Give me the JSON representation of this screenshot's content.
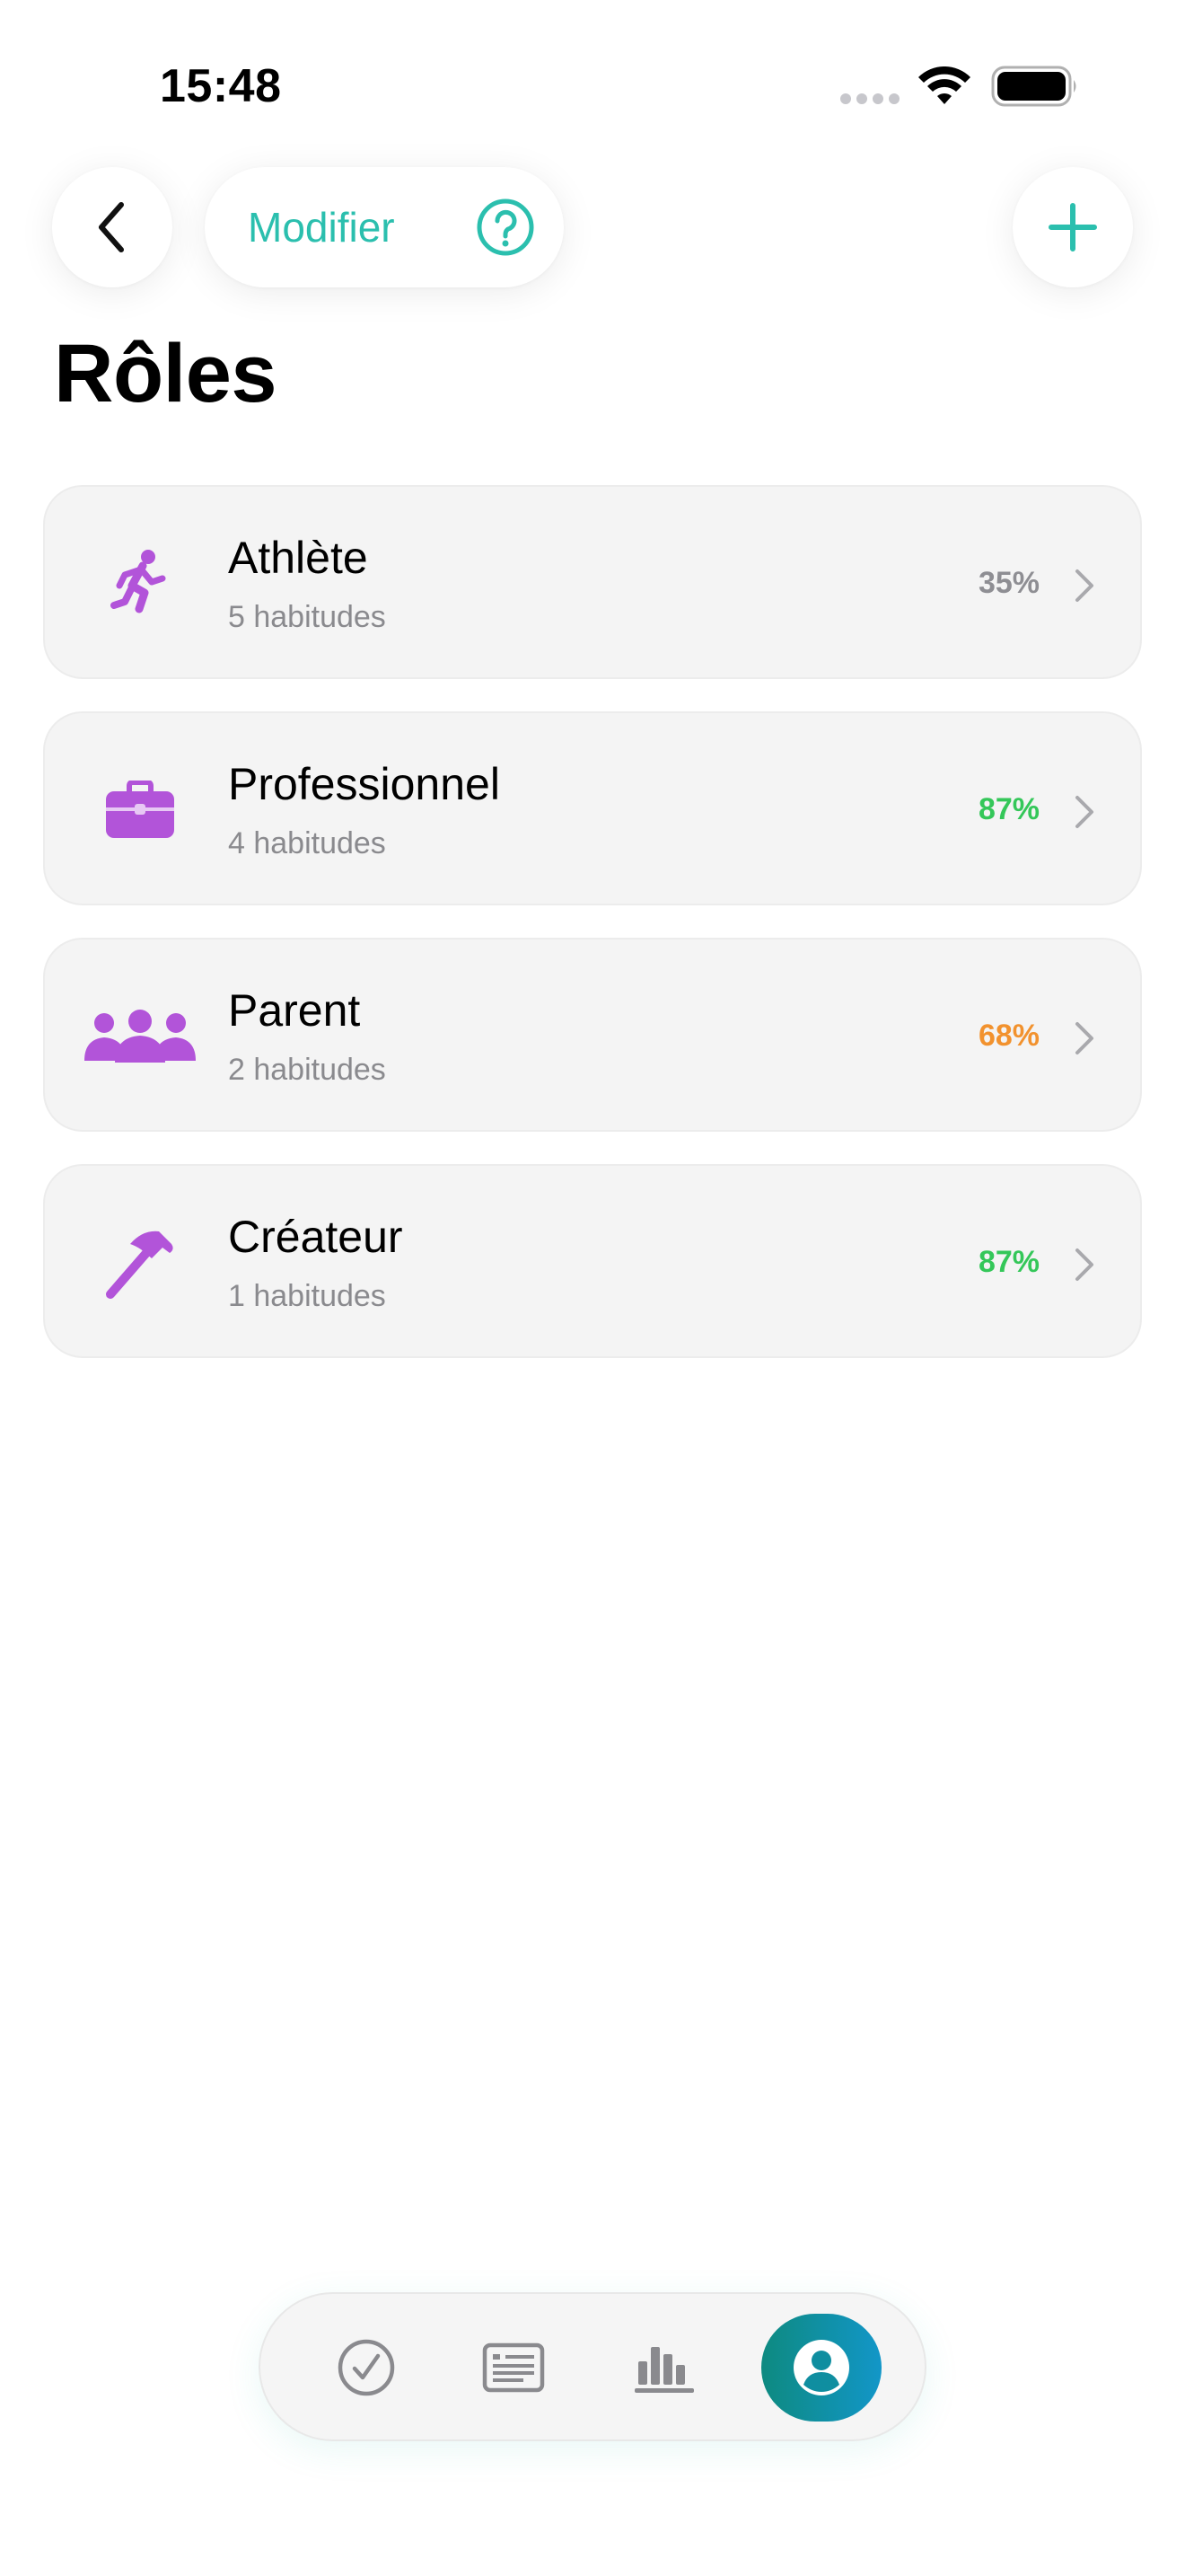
{
  "status_bar": {
    "time": "15:48"
  },
  "header": {
    "edit_label": "Modifier"
  },
  "page": {
    "title": "Rôles"
  },
  "roles": [
    {
      "name": "Athlète",
      "count": "5 habitudes",
      "percent": "35%",
      "percent_color": "#8e8e93",
      "icon": "running-person-icon"
    },
    {
      "name": "Professionnel",
      "count": "4 habitudes",
      "percent": "87%",
      "percent_color": "#34c759",
      "icon": "briefcase-icon"
    },
    {
      "name": "Parent",
      "count": "2 habitudes",
      "percent": "68%",
      "percent_color": "#f2922e",
      "icon": "group-icon"
    },
    {
      "name": "Créateur",
      "count": "1 habitudes",
      "percent": "87%",
      "percent_color": "#34c759",
      "icon": "hammer-icon"
    }
  ],
  "colors": {
    "accent": "#2bbfae",
    "role_icon": "#b254d9",
    "tab_active_start": "#0e8a80",
    "tab_active_end": "#1296c8"
  },
  "tab_bar": {
    "active_tab": "profile"
  }
}
